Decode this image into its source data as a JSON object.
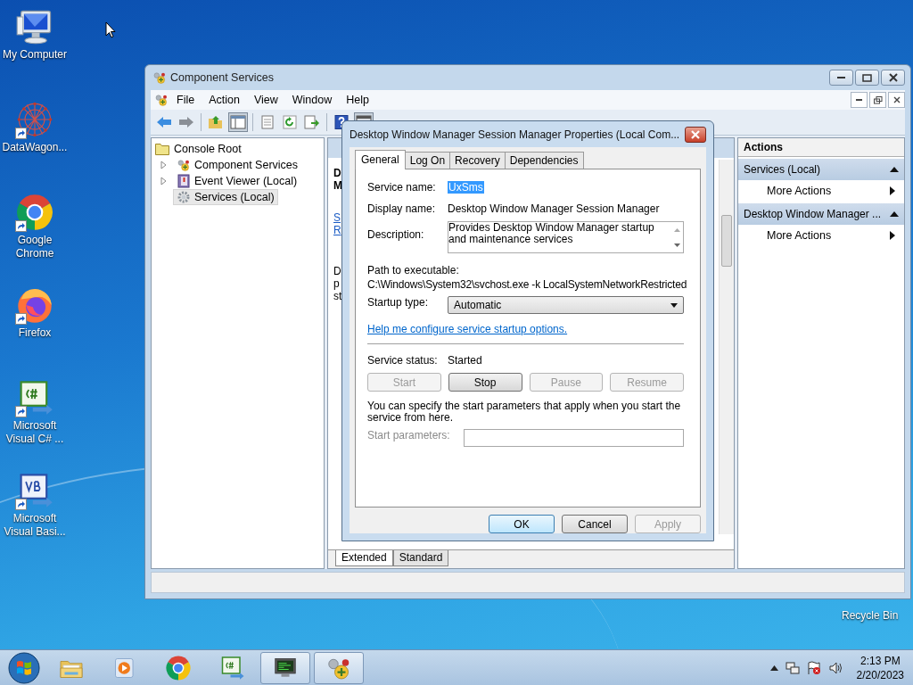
{
  "desktop_icons": [
    {
      "label": "My Computer",
      "kind": "computer",
      "shortcut": false
    },
    {
      "label": "DataWagon...",
      "kind": "graph",
      "shortcut": true
    },
    {
      "label": "Google Chrome",
      "kind": "chrome",
      "shortcut": true
    },
    {
      "label": "Firefox",
      "kind": "firefox",
      "shortcut": true
    },
    {
      "label": "Microsoft Visual C# ...",
      "kind": "csharp",
      "shortcut": true
    },
    {
      "label": "Microsoft Visual Basi...",
      "kind": "vb",
      "shortcut": true
    }
  ],
  "recycle_bin": {
    "label": "Recycle Bin"
  },
  "window": {
    "title": "Component Services",
    "menu": [
      "File",
      "Action",
      "View",
      "Window",
      "Help"
    ],
    "tree": {
      "label": "Console Root",
      "children": [
        {
          "label": "Component Services",
          "kind": "components",
          "expandable": true,
          "selected": false
        },
        {
          "label": "Event Viewer (Local)",
          "kind": "events",
          "expandable": true,
          "selected": false
        },
        {
          "label": "Services (Local)",
          "kind": "services",
          "expandable": false,
          "selected": true
        }
      ]
    },
    "middle_pane": {
      "heading": [
        "D",
        "M"
      ],
      "links": [
        "S",
        "R"
      ],
      "description": [
        "D",
        "p",
        "st"
      ]
    },
    "view_tabs": [
      {
        "label": "Extended",
        "selected": true
      },
      {
        "label": "Standard",
        "selected": false
      }
    ],
    "actions": {
      "title": "Actions",
      "sections": [
        {
          "title": "Services (Local)",
          "items": [
            "More Actions"
          ]
        },
        {
          "title": "Desktop Window Manager ...",
          "items": [
            "More Actions"
          ]
        }
      ]
    }
  },
  "dialog": {
    "title": "Desktop Window Manager Session Manager Properties (Local Com...",
    "tabs": [
      {
        "label": "General",
        "selected": true
      },
      {
        "label": "Log On",
        "selected": false
      },
      {
        "label": "Recovery",
        "selected": false
      },
      {
        "label": "Dependencies",
        "selected": false
      }
    ],
    "service_name": {
      "label": "Service name:",
      "value": "UxSms",
      "selected": true
    },
    "display_name": {
      "label": "Display name:",
      "value": "Desktop Window Manager Session Manager"
    },
    "description": {
      "label": "Description:",
      "value": "Provides Desktop Window Manager startup and maintenance services"
    },
    "path": {
      "label": "Path to executable:",
      "value": "C:\\Windows\\System32\\svchost.exe -k LocalSystemNetworkRestricted"
    },
    "startup_type": {
      "label": "Startup type:",
      "value": "Automatic"
    },
    "help_link": "Help me configure service startup options.",
    "service_status": {
      "label": "Service status:",
      "value": "Started"
    },
    "control_buttons": [
      {
        "label": "Start",
        "disabled": true
      },
      {
        "label": "Stop",
        "disabled": false
      },
      {
        "label": "Pause",
        "disabled": true
      },
      {
        "label": "Resume",
        "disabled": true
      }
    ],
    "note": "You can specify the start parameters that apply when you start the service from here.",
    "start_parameters": {
      "label": "Start parameters:",
      "disabled": true
    },
    "footer_buttons": [
      {
        "label": "OK",
        "default": true,
        "disabled": false
      },
      {
        "label": "Cancel",
        "default": false,
        "disabled": false
      },
      {
        "label": "Apply",
        "default": false,
        "disabled": true
      }
    ]
  },
  "taskbar": {
    "items": [
      {
        "kind": "explorer",
        "open": false
      },
      {
        "kind": "media",
        "open": false
      },
      {
        "kind": "chrome",
        "open": false
      },
      {
        "kind": "csharp",
        "open": false
      },
      {
        "kind": "monitor",
        "open": true
      },
      {
        "kind": "services",
        "open": true
      }
    ],
    "time": "2:13 PM",
    "date": "2/20/2023"
  }
}
